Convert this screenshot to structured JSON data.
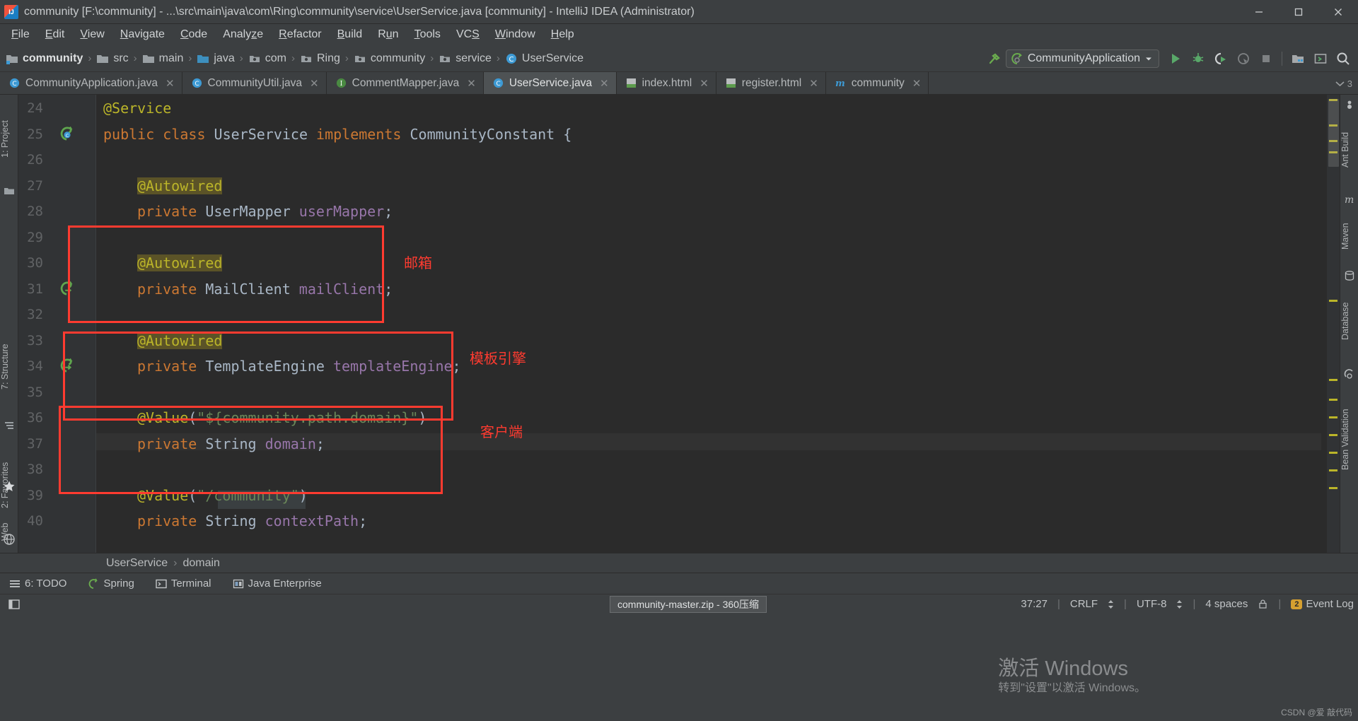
{
  "window": {
    "title": "community [F:\\community] - ...\\src\\main\\java\\com\\Ring\\community\\service\\UserService.java [community] - IntelliJ IDEA (Administrator)",
    "minimize_label": "Minimize",
    "maximize_label": "Maximize",
    "close_label": "Close"
  },
  "menubar": {
    "items": [
      {
        "label": "File",
        "mnemonic": "F"
      },
      {
        "label": "Edit",
        "mnemonic": "E"
      },
      {
        "label": "View",
        "mnemonic": "V"
      },
      {
        "label": "Navigate",
        "mnemonic": "N"
      },
      {
        "label": "Code",
        "mnemonic": "C"
      },
      {
        "label": "Analyze",
        "mnemonic": "z"
      },
      {
        "label": "Refactor",
        "mnemonic": "R"
      },
      {
        "label": "Build",
        "mnemonic": "B"
      },
      {
        "label": "Run",
        "mnemonic": "u"
      },
      {
        "label": "Tools",
        "mnemonic": "T"
      },
      {
        "label": "VCS",
        "mnemonic": "S"
      },
      {
        "label": "Window",
        "mnemonic": "W"
      },
      {
        "label": "Help",
        "mnemonic": "H"
      }
    ]
  },
  "breadcrumb": {
    "items": [
      {
        "label": "community",
        "icon": "module-icon",
        "bold": true
      },
      {
        "label": "src",
        "icon": "folder-icon",
        "bold": false
      },
      {
        "label": "main",
        "icon": "folder-icon",
        "bold": false
      },
      {
        "label": "java",
        "icon": "source-root-icon",
        "bold": false
      },
      {
        "label": "com",
        "icon": "package-icon",
        "bold": false
      },
      {
        "label": "Ring",
        "icon": "package-icon",
        "bold": false
      },
      {
        "label": "community",
        "icon": "package-icon",
        "bold": false
      },
      {
        "label": "service",
        "icon": "package-icon",
        "bold": false
      },
      {
        "label": "UserService",
        "icon": "class-icon",
        "bold": false
      }
    ]
  },
  "toolbar": {
    "run_config": "CommunityApplication",
    "buttons": [
      {
        "name": "build-hammer-button",
        "label": "Build"
      },
      {
        "name": "run-button",
        "label": "Run"
      },
      {
        "name": "debug-button",
        "label": "Debug"
      },
      {
        "name": "run-coverage-button",
        "label": "Run with Coverage"
      },
      {
        "name": "profiler-button",
        "label": "Profile"
      },
      {
        "name": "stop-button",
        "label": "Stop"
      },
      {
        "name": "project-structure-button",
        "label": "Project Structure"
      },
      {
        "name": "terminal-button",
        "label": "Terminal"
      },
      {
        "name": "search-everywhere-button",
        "label": "Search Everywhere"
      }
    ]
  },
  "tabs": {
    "items": [
      {
        "label": "CommunityApplication.java",
        "icon": "java-class-icon",
        "active": false
      },
      {
        "label": "CommunityUtil.java",
        "icon": "java-class-icon",
        "active": false
      },
      {
        "label": "CommentMapper.java",
        "icon": "java-interface-icon",
        "active": false
      },
      {
        "label": "UserService.java",
        "icon": "java-class-icon",
        "active": true
      },
      {
        "label": "index.html",
        "icon": "html-file-icon",
        "active": false
      },
      {
        "label": "register.html",
        "icon": "html-file-icon",
        "active": false
      },
      {
        "label": "community",
        "icon": "maven-module-icon",
        "active": false
      }
    ],
    "overflow_count": "3"
  },
  "left_tool_window": {
    "items": [
      {
        "label": "1: Project",
        "name": "tool-window-project"
      },
      {
        "label": "7: Structure",
        "name": "tool-window-structure"
      },
      {
        "label": "2: Favorites",
        "name": "tool-window-favorites"
      },
      {
        "label": "Web",
        "name": "tool-window-web"
      }
    ]
  },
  "right_tool_window": {
    "items": [
      {
        "label": "Ant Build",
        "name": "tool-window-ant-build"
      },
      {
        "label": "Maven",
        "name": "tool-window-maven"
      },
      {
        "label": "Database",
        "name": "tool-window-database"
      },
      {
        "label": "Bean Validation",
        "name": "tool-window-bean-validation"
      }
    ]
  },
  "editor": {
    "first_line_number": 24,
    "lines": [
      {
        "num": "24",
        "tokens": [
          {
            "t": "@Service",
            "c": "k-ann"
          }
        ]
      },
      {
        "num": "25",
        "tokens": [
          {
            "t": "public class ",
            "c": "k-kw"
          },
          {
            "t": "UserService ",
            "c": "k-cls"
          },
          {
            "t": "implements ",
            "c": "k-kw"
          },
          {
            "t": "CommunityConstant ",
            "c": "k-cls"
          },
          {
            "t": "{",
            "c": "k-punc"
          }
        ],
        "gutter_icon": "spring-bean-icon"
      },
      {
        "num": "26",
        "tokens": []
      },
      {
        "num": "27",
        "tokens": [
          {
            "t": "@Autowired",
            "c": "k-ann",
            "hl": true
          }
        ],
        "indent": 1
      },
      {
        "num": "28",
        "tokens": [
          {
            "t": "private ",
            "c": "k-kw"
          },
          {
            "t": "UserMapper ",
            "c": "k-cls"
          },
          {
            "t": "userMapper",
            "c": "k-fld"
          },
          {
            "t": ";",
            "c": "k-punc"
          }
        ],
        "indent": 1
      },
      {
        "num": "29",
        "tokens": []
      },
      {
        "num": "30",
        "tokens": [
          {
            "t": "@Autowired",
            "c": "k-ann",
            "hl": true
          }
        ],
        "indent": 1
      },
      {
        "num": "31",
        "tokens": [
          {
            "t": "private ",
            "c": "k-kw"
          },
          {
            "t": "MailClient ",
            "c": "k-cls"
          },
          {
            "t": "mailClient",
            "c": "k-fld"
          },
          {
            "t": ";",
            "c": "k-punc"
          }
        ],
        "indent": 1,
        "gutter_icon": "bean-autowired-icon"
      },
      {
        "num": "32",
        "tokens": []
      },
      {
        "num": "33",
        "tokens": [
          {
            "t": "@Autowired",
            "c": "k-ann",
            "hl": true
          }
        ],
        "indent": 1
      },
      {
        "num": "34",
        "tokens": [
          {
            "t": "private ",
            "c": "k-kw"
          },
          {
            "t": "TemplateEngine ",
            "c": "k-cls"
          },
          {
            "t": "templateEngine",
            "c": "k-fld"
          },
          {
            "t": ";",
            "c": "k-punc"
          }
        ],
        "indent": 1,
        "gutter_icon": "bean-autowired-icon"
      },
      {
        "num": "35",
        "tokens": []
      },
      {
        "num": "36",
        "tokens": [
          {
            "t": "@Value",
            "c": "k-ann"
          },
          {
            "t": "(",
            "c": "k-punc"
          },
          {
            "t": "\"${community.path.domain}\"",
            "c": "k-str"
          },
          {
            "t": ")",
            "c": "k-punc"
          }
        ],
        "indent": 1
      },
      {
        "num": "37",
        "tokens": [
          {
            "t": "private ",
            "c": "k-kw"
          },
          {
            "t": "String ",
            "c": "k-cls"
          },
          {
            "t": "domain",
            "c": "k-fld"
          },
          {
            "t": ";",
            "c": "k-punc"
          }
        ],
        "indent": 1,
        "caret": true
      },
      {
        "num": "38",
        "tokens": []
      },
      {
        "num": "39",
        "tokens": [
          {
            "t": "@Value",
            "c": "k-ann"
          },
          {
            "t": "(",
            "c": "k-punc"
          },
          {
            "t": "\"/community\"",
            "c": "k-str"
          },
          {
            "t": ")",
            "c": "k-punc"
          }
        ],
        "indent": 1
      },
      {
        "num": "40",
        "tokens": [
          {
            "t": "private ",
            "c": "k-kw"
          },
          {
            "t": "String ",
            "c": "k-cls"
          },
          {
            "t": "contextPath",
            "c": "k-fld"
          },
          {
            "t": ";",
            "c": "k-punc"
          }
        ],
        "indent": 1
      }
    ],
    "annotations": [
      {
        "name": "annotation-mail-client",
        "text": "邮箱"
      },
      {
        "name": "annotation-template-engine",
        "text": "模板引擎"
      },
      {
        "name": "annotation-client-domain",
        "text": "客户端"
      }
    ],
    "breadcrumb": {
      "class": "UserService",
      "member": "domain",
      "separator": "›"
    }
  },
  "bottom_bar": {
    "items": [
      {
        "label": "6: TODO",
        "icon": "todo-icon",
        "mnemonic": "6"
      },
      {
        "label": "Spring",
        "icon": "spring-icon"
      },
      {
        "label": "Terminal",
        "icon": "terminal-icon"
      },
      {
        "label": "Java Enterprise",
        "icon": "java-ee-icon"
      }
    ]
  },
  "status_bar": {
    "taskbar_item": "community-master.zip - 360压缩",
    "caret_position": "37:27",
    "line_separator": "CRLF",
    "encoding": "UTF-8",
    "indent": "4 spaces",
    "event_log": "Event Log",
    "event_log_badge": "2"
  },
  "watermark": {
    "line1": "激活 Windows",
    "line2": "转到\"设置\"以激活 Windows。",
    "csdn": "CSDN @爱 敲代码"
  },
  "colors": {
    "accent_red": "#ff3b30",
    "editor_bg": "#2b2b2b",
    "chrome_bg": "#3c3f41",
    "annotation_yellow": "#bbb529",
    "keyword_orange": "#cc7832",
    "field_purple": "#9876aa",
    "string_green": "#6a8759",
    "class_blue": "#a9b7c6"
  }
}
